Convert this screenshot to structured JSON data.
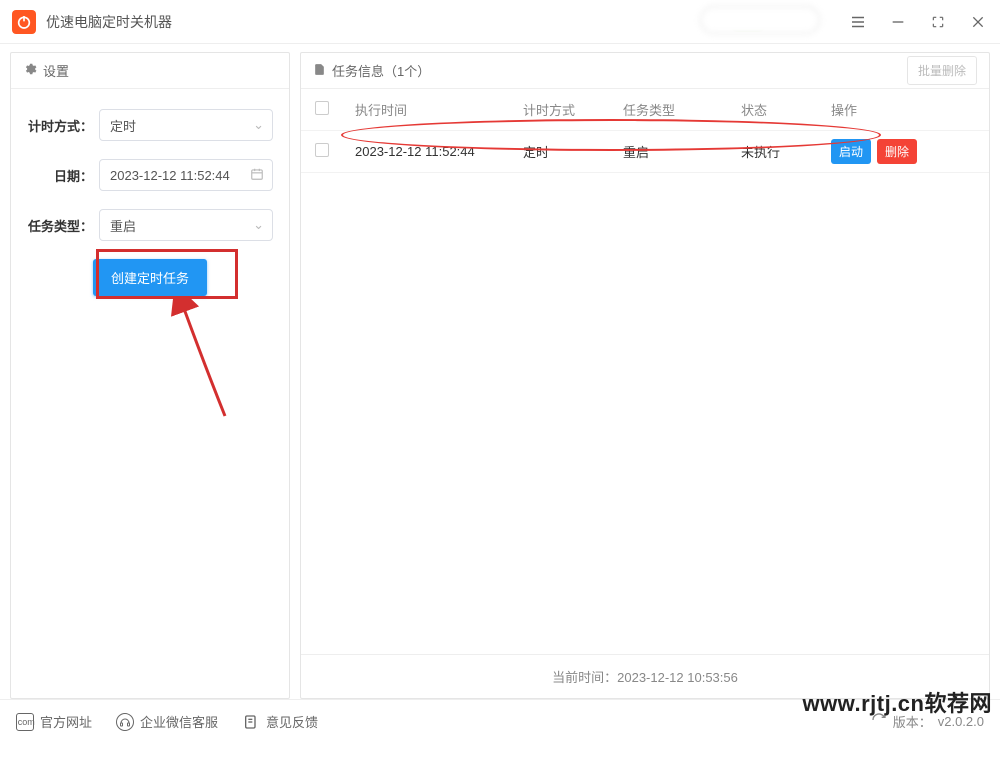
{
  "app": {
    "title": "优速电脑定时关机器"
  },
  "left": {
    "settings_label": "设置",
    "labels": {
      "mode": "计时方式：",
      "date": "日期：",
      "type": "任务类型："
    },
    "values": {
      "mode": "定时",
      "date": "2023-12-12 11:52:44",
      "type": "重启"
    },
    "create_btn": "创建定时任务"
  },
  "right": {
    "header": "任务信息（1个）",
    "batch_delete": "批量删除",
    "columns": {
      "time": "执行时间",
      "mode": "计时方式",
      "type": "任务类型",
      "status": "状态",
      "ops": "操作"
    },
    "row": {
      "time": "2023-12-12 11:52:44",
      "mode": "定时",
      "type": "重启",
      "status": "未执行",
      "start": "启动",
      "delete": "删除"
    },
    "footer_label": "当前时间：",
    "footer_time": "2023-12-12 10:53:56"
  },
  "bottom": {
    "site": "官方网址",
    "wecom": "企业微信客服",
    "feedback": "意见反馈",
    "version_label": "版本：",
    "version": "v2.0.2.0"
  },
  "watermark": "www.rjtj.cn软荐网"
}
